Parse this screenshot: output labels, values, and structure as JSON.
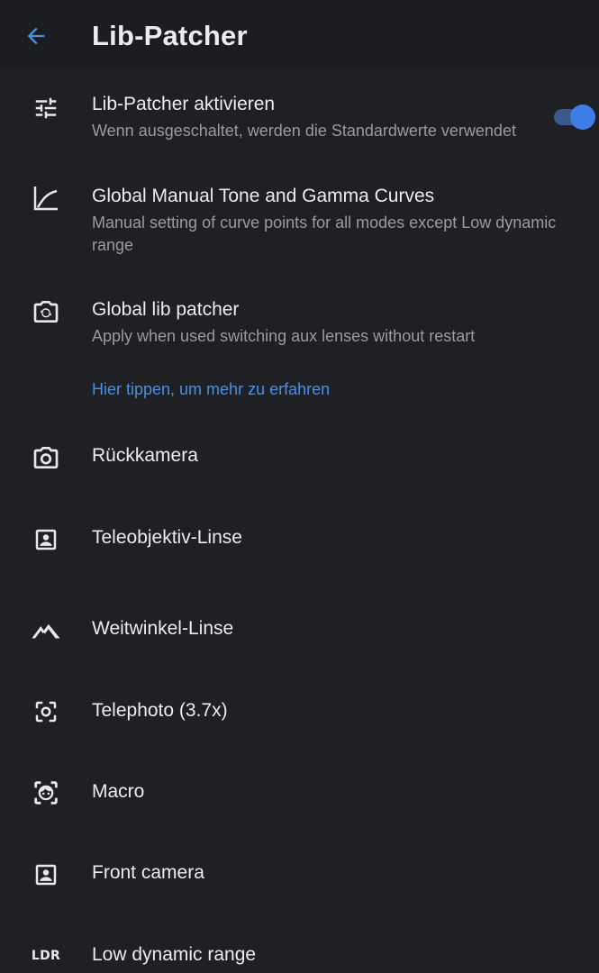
{
  "appbar": {
    "title": "Lib-Patcher",
    "back_icon": "arrow-back-icon"
  },
  "colors": {
    "background": "#1f2024",
    "accent": "#3f7ee6",
    "link": "#4d8ee0"
  },
  "settings": [
    {
      "title": "Lib-Patcher aktivieren",
      "summary": "Wenn ausgeschaltet, werden die Standardwerte verwendet",
      "icon": "tune-sliders-icon",
      "toggle_on": true
    },
    {
      "title": "Global Manual Tone and Gamma Curves",
      "summary": "Manual setting of curve points for all modes except Low dynamic range",
      "icon": "curve-graph-icon"
    },
    {
      "title": "Global lib patcher",
      "summary": "Apply when used switching aux lenses without restart",
      "icon": "camera-switch-icon"
    }
  ],
  "learn_more": "Hier tippen, um mehr zu erfahren",
  "lenses": [
    {
      "title": "Rückkamera",
      "icon": "camera-icon"
    },
    {
      "title": "Teleobjektiv-Linse",
      "icon": "portrait-frame-icon"
    },
    {
      "title": "Weitwinkel-Linse",
      "icon": "landscape-icon"
    },
    {
      "title": "Telephoto (3.7x)",
      "icon": "focus-frame-icon"
    },
    {
      "title": "Macro",
      "icon": "face-frame-icon"
    },
    {
      "title": "Front camera",
      "icon": "portrait-frame-icon"
    },
    {
      "title": "Low dynamic range",
      "icon": "ldr-icon",
      "icon_text": "LDR"
    }
  ]
}
